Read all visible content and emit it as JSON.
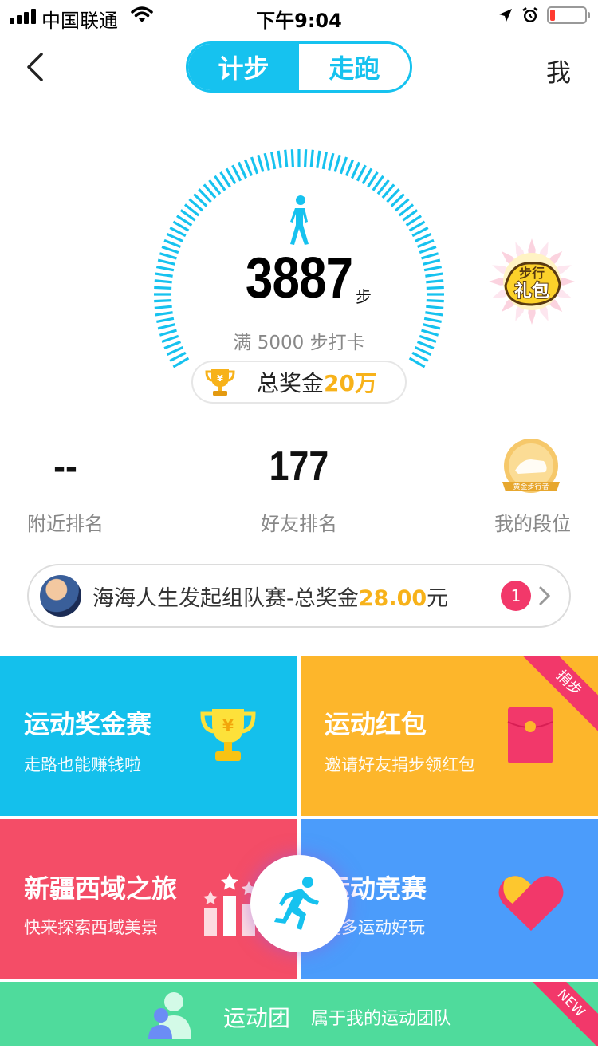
{
  "status_bar": {
    "carrier": "中国联通",
    "time": "下午9:04",
    "battery_level": 0.15
  },
  "nav": {
    "tabs": [
      {
        "label": "计步",
        "active": true
      },
      {
        "label": "走跑",
        "active": false
      }
    ],
    "me_label": "我"
  },
  "pedometer": {
    "steps": "3887",
    "unit": "步",
    "goal_text": "满 5000 步打卡",
    "prize_label": "总奖金",
    "prize_amount": "20万"
  },
  "gift": {
    "text_top": "步行",
    "text_main": "礼包"
  },
  "ranking": [
    {
      "value": "--",
      "label": "附近排名"
    },
    {
      "value": "177",
      "label": "好友排名"
    },
    {
      "value": "",
      "label": "我的段位"
    }
  ],
  "medal_text": "黄金步行者",
  "team_banner": {
    "text": "海海人生发起组队赛-总奖金",
    "amount": "28.00",
    "unit": "元",
    "badge": "1"
  },
  "tiles": [
    {
      "title": "运动奖金赛",
      "subtitle": "走路也能赚钱啦"
    },
    {
      "title": "运动红包",
      "subtitle": "邀请好友捐步领红包",
      "ribbon": "捐步"
    },
    {
      "title": "新疆西域之旅",
      "subtitle": "快来探索西域美景"
    },
    {
      "title": "运动竞赛",
      "subtitle": "更多运动好玩"
    }
  ],
  "bottom_bar": {
    "title": "运动团",
    "subtitle": "属于我的运动团队",
    "ribbon": "NEW"
  },
  "colors": {
    "accent": "#16c2ef",
    "gold": "#f7b21a",
    "tile_blue": "#14c0ec",
    "tile_orange": "#fdb62b",
    "tile_red": "#f44d67",
    "tile_periwinkle": "#4b9cfb",
    "tile_green": "#4fdb9c",
    "badge_pink": "#f2386a"
  }
}
